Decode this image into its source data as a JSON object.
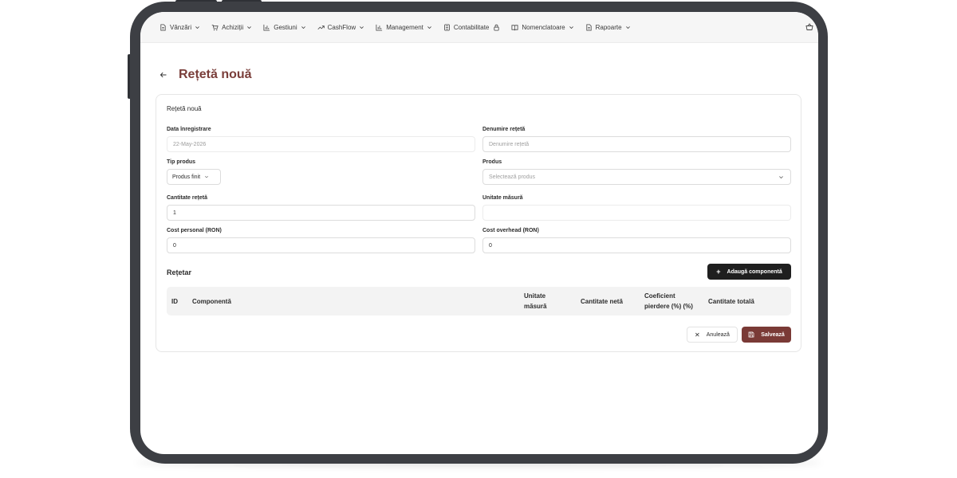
{
  "nav": {
    "items": [
      {
        "label": "Vânzări",
        "icon": "document-icon",
        "chevron": true
      },
      {
        "label": "Achiziții",
        "icon": "cart-icon",
        "chevron": true
      },
      {
        "label": "Gestiuni",
        "icon": "bar-chart-icon",
        "chevron": true
      },
      {
        "label": "CashFlow",
        "icon": "trend-icon",
        "chevron": true
      },
      {
        "label": "Management",
        "icon": "bar-chart-icon",
        "chevron": true
      },
      {
        "label": "Contabilitate",
        "icon": "ledger-icon",
        "chevron": false,
        "lock": true
      },
      {
        "label": "Nomenclatoare",
        "icon": "book-icon",
        "chevron": true
      },
      {
        "label": "Rapoarte",
        "icon": "document-icon",
        "chevron": true
      }
    ]
  },
  "page": {
    "title": "Rețetă nouă"
  },
  "form": {
    "card_title": "Rețetă nouă",
    "date_label": "Data înregistrare",
    "date_value": "22-May-2026",
    "name_label": "Denumire rețetă",
    "name_placeholder": "Denumire rețetă",
    "type_label": "Tip produs",
    "type_value": "Produs finit",
    "product_label": "Produs",
    "product_placeholder": "Selectează produs",
    "quantity_label": "Cantitate rețetă",
    "quantity_value": "1",
    "unit_label": "Unitate măsură",
    "unit_value": "",
    "personal_cost_label": "Cost personal (RON)",
    "personal_cost_value": "0",
    "overhead_cost_label": "Cost overhead (RON)",
    "overhead_cost_value": "0"
  },
  "recipe": {
    "section_title": "Rețetar",
    "add_button": "Adaugă componentă",
    "columns": {
      "id": "ID",
      "component": "Componentă",
      "unit_line1": "Unitate",
      "unit_line2": "măsură",
      "net_qty": "Cantitate netă",
      "loss_line1": "Coeficient",
      "loss_line2": "pierdere (%) (%)",
      "total_qty": "Cantitate totală"
    }
  },
  "actions": {
    "cancel": "Anulează",
    "save": "Salvează"
  },
  "colors": {
    "accent": "#7a3e3a",
    "save_button": "#7a3a36",
    "dark_button": "#1f1f1f",
    "device_frame": "#3d3f44"
  }
}
